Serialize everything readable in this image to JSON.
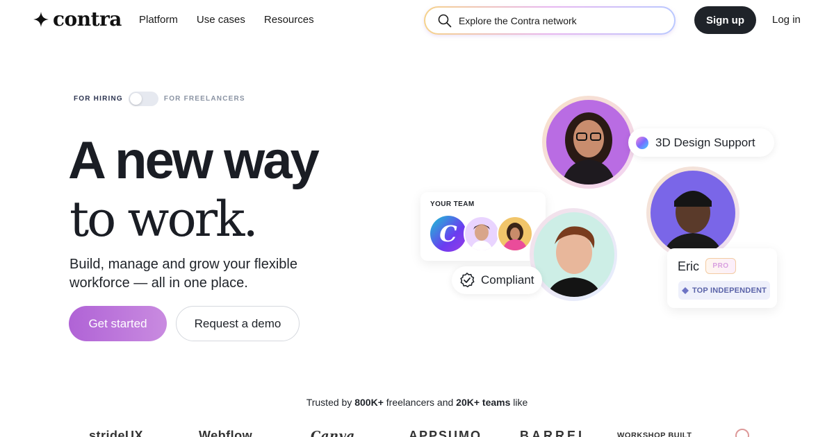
{
  "header": {
    "logo_text": "contra",
    "nav": [
      "Platform",
      "Use cases",
      "Resources"
    ],
    "search_placeholder": "Explore the Contra network",
    "signup_label": "Sign up",
    "login_label": "Log in"
  },
  "toggle": {
    "left_label": "FOR HIRING",
    "right_label": "FOR FREELANCERS"
  },
  "hero": {
    "line1": "A new way",
    "line2": "to work.",
    "subtitle": "Build, manage and grow your flexible workforce — all in one place.",
    "primary_cta": "Get started",
    "secondary_cta": "Request a demo"
  },
  "illustration": {
    "chip_3d": "3D Design Support",
    "team_label": "YOUR TEAM",
    "team_logo_letter": "C",
    "compliant_label": "Compliant",
    "eric_name": "Eric",
    "pro_label": "PRO",
    "top_independent": "TOP INDEPENDENT"
  },
  "trusted": {
    "prefix": "Trusted by ",
    "freelancers": "800K+",
    "middle": " freelancers and ",
    "teams": "20K+ teams",
    "suffix": " like"
  },
  "brands": [
    "strideUX",
    "Webflow",
    "Canva",
    "APPSUMO",
    "BARREL",
    "WORKSHOP BUILT"
  ],
  "colors": {
    "accent_purple": "#b063d6",
    "dark_button": "#1f2329",
    "avatar_bg_purple": "#b96ce3",
    "avatar_bg_violet": "#7a66e8",
    "avatar_bg_mint": "#cdeee6"
  }
}
